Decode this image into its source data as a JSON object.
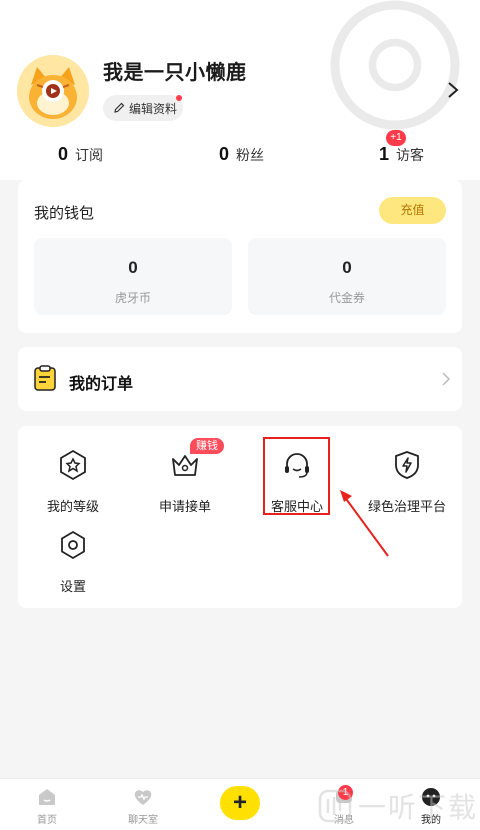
{
  "profile": {
    "username": "我是一只小懒鹿",
    "edit_label": "编辑资料"
  },
  "stats": [
    {
      "value": "0",
      "label": "订阅"
    },
    {
      "value": "0",
      "label": "粉丝"
    },
    {
      "value": "1",
      "label": "访客",
      "badge": "+1"
    }
  ],
  "wallet": {
    "title": "我的钱包",
    "recharge_label": "充值",
    "items": [
      {
        "value": "0",
        "label": "虎牙币"
      },
      {
        "value": "0",
        "label": "代金券"
      }
    ]
  },
  "orders": {
    "title": "我的订单"
  },
  "menu": {
    "items": [
      {
        "label": "我的等级",
        "icon": "level-badge-icon"
      },
      {
        "label": "申请接单",
        "icon": "crown-icon",
        "badge": "赚钱"
      },
      {
        "label": "客服中心",
        "icon": "headset-icon"
      },
      {
        "label": "绿色治理平台",
        "icon": "shield-bolt-icon"
      },
      {
        "label": "设置",
        "icon": "settings-icon"
      }
    ]
  },
  "tabbar": {
    "items": [
      {
        "label": "首页",
        "icon": "home-icon"
      },
      {
        "label": "聊天室",
        "icon": "heart-chat-icon"
      },
      {
        "label": "+",
        "icon": "plus-icon"
      },
      {
        "label": "消息",
        "icon": "message-icon",
        "badge": "1"
      },
      {
        "label": "我的",
        "icon": "profile-icon",
        "active": true
      }
    ]
  },
  "watermark": {
    "text": "一听下载"
  },
  "colors": {
    "accent_yellow": "#ffe000",
    "badge_red": "#ff3b4a",
    "highlight_red": "#e8211c"
  }
}
